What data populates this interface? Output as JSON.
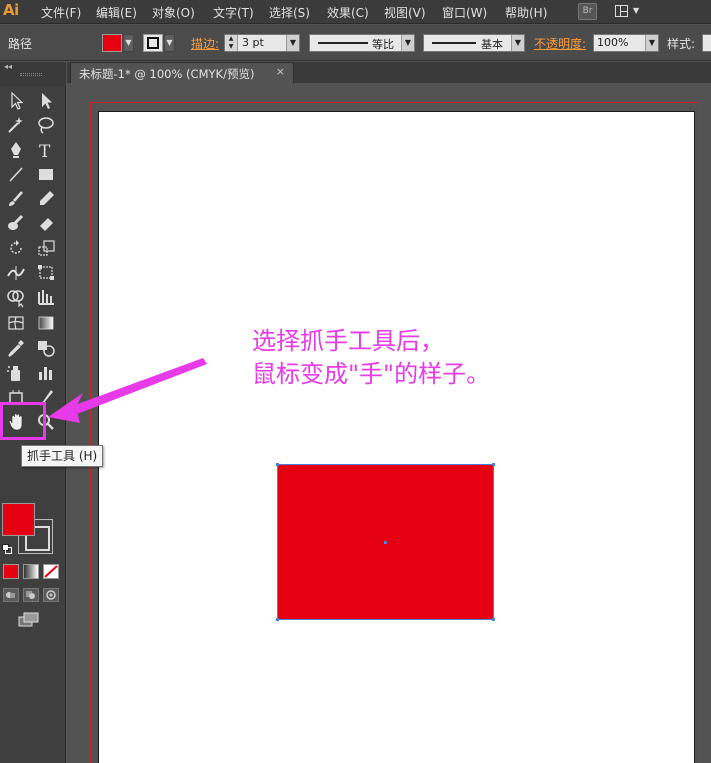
{
  "app": {
    "logo": "Ai"
  },
  "menubar": {
    "items": [
      "文件(F)",
      "编辑(E)",
      "对象(O)",
      "文字(T)",
      "选择(S)",
      "效果(C)",
      "视图(V)",
      "窗口(W)",
      "帮助(H)"
    ],
    "bridge_label": "Br"
  },
  "controlbar": {
    "path_label": "路径",
    "fill_color": "#e50012",
    "stroke_label": "描边:",
    "stroke_weight": "3 pt",
    "profile_label": "等比",
    "brush_label": "基本",
    "opacity_label": "不透明度:",
    "opacity_value": "100%",
    "style_label": "样式:"
  },
  "document": {
    "tab_title": "未标题-1* @ 100% (CMYK/预览)",
    "tab_close": "×"
  },
  "toolbar": {
    "tools": [
      "selection-tool",
      "direct-selection-tool",
      "magic-wand-tool",
      "lasso-tool",
      "pen-tool",
      "type-tool",
      "line-segment-tool",
      "rectangle-tool",
      "paintbrush-tool",
      "pencil-tool",
      "blob-brush-tool",
      "eraser-tool",
      "rotate-tool",
      "scale-tool",
      "width-tool",
      "free-transform-tool",
      "shape-builder-tool",
      "perspective-grid-tool",
      "mesh-tool",
      "gradient-tool",
      "eyedropper-tool",
      "blend-tool",
      "symbol-sprayer-tool",
      "column-graph-tool",
      "artboard-tool",
      "slice-tool",
      "hand-tool",
      "zoom-tool"
    ],
    "tooltip": "抓手工具 (H)",
    "fill_color": "#e50012"
  },
  "canvas": {
    "annotation_line1": "选择抓手工具后，",
    "annotation_line2": "鼠标变成\"手\"的样子。",
    "annotation_color": "#e83ae8",
    "rect_fill": "#e50012"
  }
}
